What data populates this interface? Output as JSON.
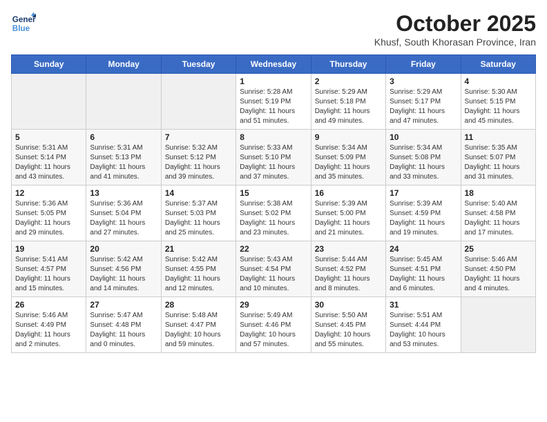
{
  "logo": {
    "line1": "General",
    "line2": "Blue"
  },
  "title": "October 2025",
  "subtitle": "Khusf, South Khorasan Province, Iran",
  "days_of_week": [
    "Sunday",
    "Monday",
    "Tuesday",
    "Wednesday",
    "Thursday",
    "Friday",
    "Saturday"
  ],
  "weeks": [
    [
      {
        "day": "",
        "content": ""
      },
      {
        "day": "",
        "content": ""
      },
      {
        "day": "",
        "content": ""
      },
      {
        "day": "1",
        "content": "Sunrise: 5:28 AM\nSunset: 5:19 PM\nDaylight: 11 hours\nand 51 minutes."
      },
      {
        "day": "2",
        "content": "Sunrise: 5:29 AM\nSunset: 5:18 PM\nDaylight: 11 hours\nand 49 minutes."
      },
      {
        "day": "3",
        "content": "Sunrise: 5:29 AM\nSunset: 5:17 PM\nDaylight: 11 hours\nand 47 minutes."
      },
      {
        "day": "4",
        "content": "Sunrise: 5:30 AM\nSunset: 5:15 PM\nDaylight: 11 hours\nand 45 minutes."
      }
    ],
    [
      {
        "day": "5",
        "content": "Sunrise: 5:31 AM\nSunset: 5:14 PM\nDaylight: 11 hours\nand 43 minutes."
      },
      {
        "day": "6",
        "content": "Sunrise: 5:31 AM\nSunset: 5:13 PM\nDaylight: 11 hours\nand 41 minutes."
      },
      {
        "day": "7",
        "content": "Sunrise: 5:32 AM\nSunset: 5:12 PM\nDaylight: 11 hours\nand 39 minutes."
      },
      {
        "day": "8",
        "content": "Sunrise: 5:33 AM\nSunset: 5:10 PM\nDaylight: 11 hours\nand 37 minutes."
      },
      {
        "day": "9",
        "content": "Sunrise: 5:34 AM\nSunset: 5:09 PM\nDaylight: 11 hours\nand 35 minutes."
      },
      {
        "day": "10",
        "content": "Sunrise: 5:34 AM\nSunset: 5:08 PM\nDaylight: 11 hours\nand 33 minutes."
      },
      {
        "day": "11",
        "content": "Sunrise: 5:35 AM\nSunset: 5:07 PM\nDaylight: 11 hours\nand 31 minutes."
      }
    ],
    [
      {
        "day": "12",
        "content": "Sunrise: 5:36 AM\nSunset: 5:05 PM\nDaylight: 11 hours\nand 29 minutes."
      },
      {
        "day": "13",
        "content": "Sunrise: 5:36 AM\nSunset: 5:04 PM\nDaylight: 11 hours\nand 27 minutes."
      },
      {
        "day": "14",
        "content": "Sunrise: 5:37 AM\nSunset: 5:03 PM\nDaylight: 11 hours\nand 25 minutes."
      },
      {
        "day": "15",
        "content": "Sunrise: 5:38 AM\nSunset: 5:02 PM\nDaylight: 11 hours\nand 23 minutes."
      },
      {
        "day": "16",
        "content": "Sunrise: 5:39 AM\nSunset: 5:00 PM\nDaylight: 11 hours\nand 21 minutes."
      },
      {
        "day": "17",
        "content": "Sunrise: 5:39 AM\nSunset: 4:59 PM\nDaylight: 11 hours\nand 19 minutes."
      },
      {
        "day": "18",
        "content": "Sunrise: 5:40 AM\nSunset: 4:58 PM\nDaylight: 11 hours\nand 17 minutes."
      }
    ],
    [
      {
        "day": "19",
        "content": "Sunrise: 5:41 AM\nSunset: 4:57 PM\nDaylight: 11 hours\nand 15 minutes."
      },
      {
        "day": "20",
        "content": "Sunrise: 5:42 AM\nSunset: 4:56 PM\nDaylight: 11 hours\nand 14 minutes."
      },
      {
        "day": "21",
        "content": "Sunrise: 5:42 AM\nSunset: 4:55 PM\nDaylight: 11 hours\nand 12 minutes."
      },
      {
        "day": "22",
        "content": "Sunrise: 5:43 AM\nSunset: 4:54 PM\nDaylight: 11 hours\nand 10 minutes."
      },
      {
        "day": "23",
        "content": "Sunrise: 5:44 AM\nSunset: 4:52 PM\nDaylight: 11 hours\nand 8 minutes."
      },
      {
        "day": "24",
        "content": "Sunrise: 5:45 AM\nSunset: 4:51 PM\nDaylight: 11 hours\nand 6 minutes."
      },
      {
        "day": "25",
        "content": "Sunrise: 5:46 AM\nSunset: 4:50 PM\nDaylight: 11 hours\nand 4 minutes."
      }
    ],
    [
      {
        "day": "26",
        "content": "Sunrise: 5:46 AM\nSunset: 4:49 PM\nDaylight: 11 hours\nand 2 minutes."
      },
      {
        "day": "27",
        "content": "Sunrise: 5:47 AM\nSunset: 4:48 PM\nDaylight: 11 hours\nand 0 minutes."
      },
      {
        "day": "28",
        "content": "Sunrise: 5:48 AM\nSunset: 4:47 PM\nDaylight: 10 hours\nand 59 minutes."
      },
      {
        "day": "29",
        "content": "Sunrise: 5:49 AM\nSunset: 4:46 PM\nDaylight: 10 hours\nand 57 minutes."
      },
      {
        "day": "30",
        "content": "Sunrise: 5:50 AM\nSunset: 4:45 PM\nDaylight: 10 hours\nand 55 minutes."
      },
      {
        "day": "31",
        "content": "Sunrise: 5:51 AM\nSunset: 4:44 PM\nDaylight: 10 hours\nand 53 minutes."
      },
      {
        "day": "",
        "content": ""
      }
    ]
  ]
}
